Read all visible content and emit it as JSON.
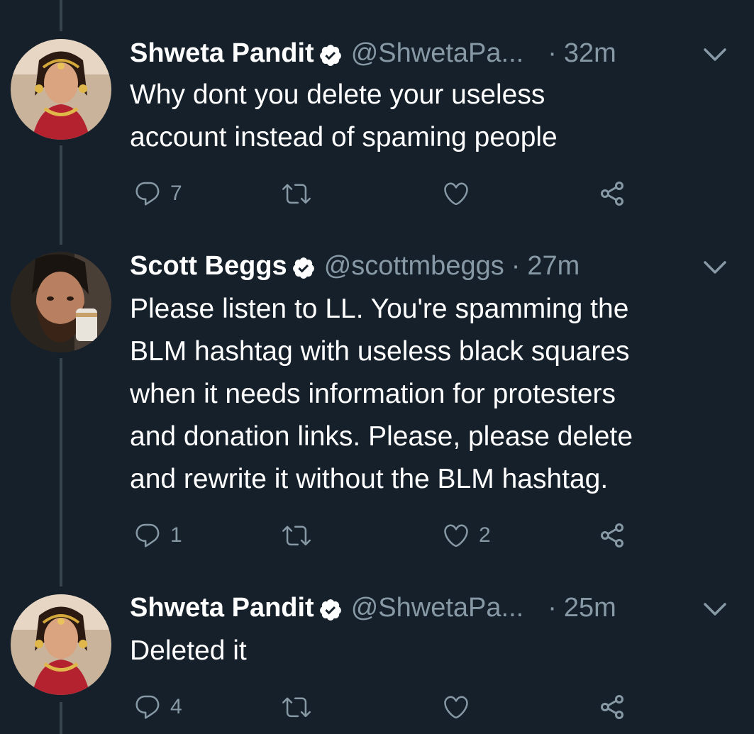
{
  "tweets": [
    {
      "name": "Shweta Pandit",
      "handle": "@ShwetaPa...",
      "time": "32m",
      "text_lines": [
        "Why dont you delete your useless",
        "account instead of spaming people"
      ],
      "reply_count": "7",
      "like_count": ""
    },
    {
      "name": "Scott Beggs",
      "handle": "@scottmbeggs",
      "time": "27m",
      "text_lines": [
        "Please listen to LL. You're spamming the",
        "BLM hashtag with useless black squares",
        "when it needs information for protesters",
        "and donation links. Please, please delete",
        "and rewrite it without the BLM hashtag."
      ],
      "reply_count": "1",
      "like_count": "2"
    },
    {
      "name": "Shweta Pandit",
      "handle": "@ShwetaPa...",
      "time": "25m",
      "text_lines": [
        "Deleted it"
      ],
      "reply_count": "4",
      "like_count": ""
    }
  ],
  "separator": "·",
  "icons": [
    "verified-badge-icon",
    "chevron-down-icon",
    "reply-icon",
    "retweet-icon",
    "like-icon",
    "share-icon"
  ],
  "colors": {
    "background": "#15202b",
    "primary_text": "#ffffff",
    "secondary_text": "#8899a6",
    "thread_line": "#38444d"
  }
}
